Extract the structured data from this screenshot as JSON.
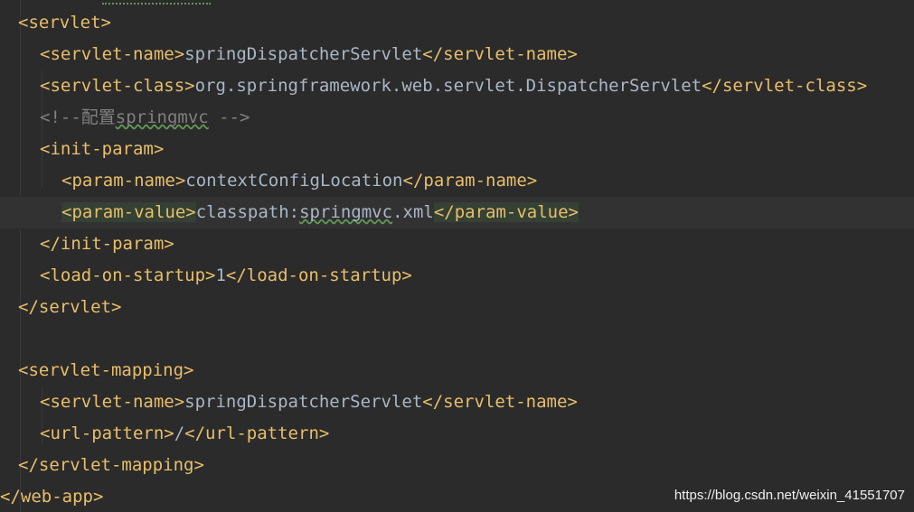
{
  "code": {
    "line1_tag": "<servlet>",
    "line2_open": "<servlet-name>",
    "line2_text": "springDispatcherServlet",
    "line2_close": "</servlet-name>",
    "line3_open": "<servlet-class>",
    "line3_text": "org.springframework.web.servlet.DispatcherServlet",
    "line3_close": "</servlet-class>",
    "line4_comment_start": "<!--配置",
    "line4_comment_word": "springmvc",
    "line4_comment_end": " -->",
    "line5_tag": "<init-param>",
    "line6_open": "<param-name>",
    "line6_text": "contextConfigLocation",
    "line6_close": "</param-name>",
    "line7_open": "<param-value>",
    "line7_text_a": "classpath:",
    "line7_text_b": "springmvc",
    "line7_text_c": ".xml",
    "line7_close": "</param-value>",
    "line8_tag": "</init-param>",
    "line9_open": "<load-on-startup>",
    "line9_text": "1",
    "line9_close": "</load-on-startup>",
    "line10_tag": "</servlet>",
    "line12_tag": "<servlet-mapping>",
    "line13_open": "<servlet-name>",
    "line13_text": "springDispatcherServlet",
    "line13_close": "</servlet-name>",
    "line14_open": "<url-pattern>",
    "line14_text": "/",
    "line14_close": "</url-pattern>",
    "line15_tag": "</servlet-mapping>",
    "line16_tag": "</web-app>"
  },
  "watermark": "https://blog.csdn.net/weixin_41551707",
  "colors": {
    "background": "#2b2b2b",
    "tag": "#e8bf6a",
    "text": "#a9b7c6",
    "comment": "#808080",
    "highlight": "#344134"
  }
}
